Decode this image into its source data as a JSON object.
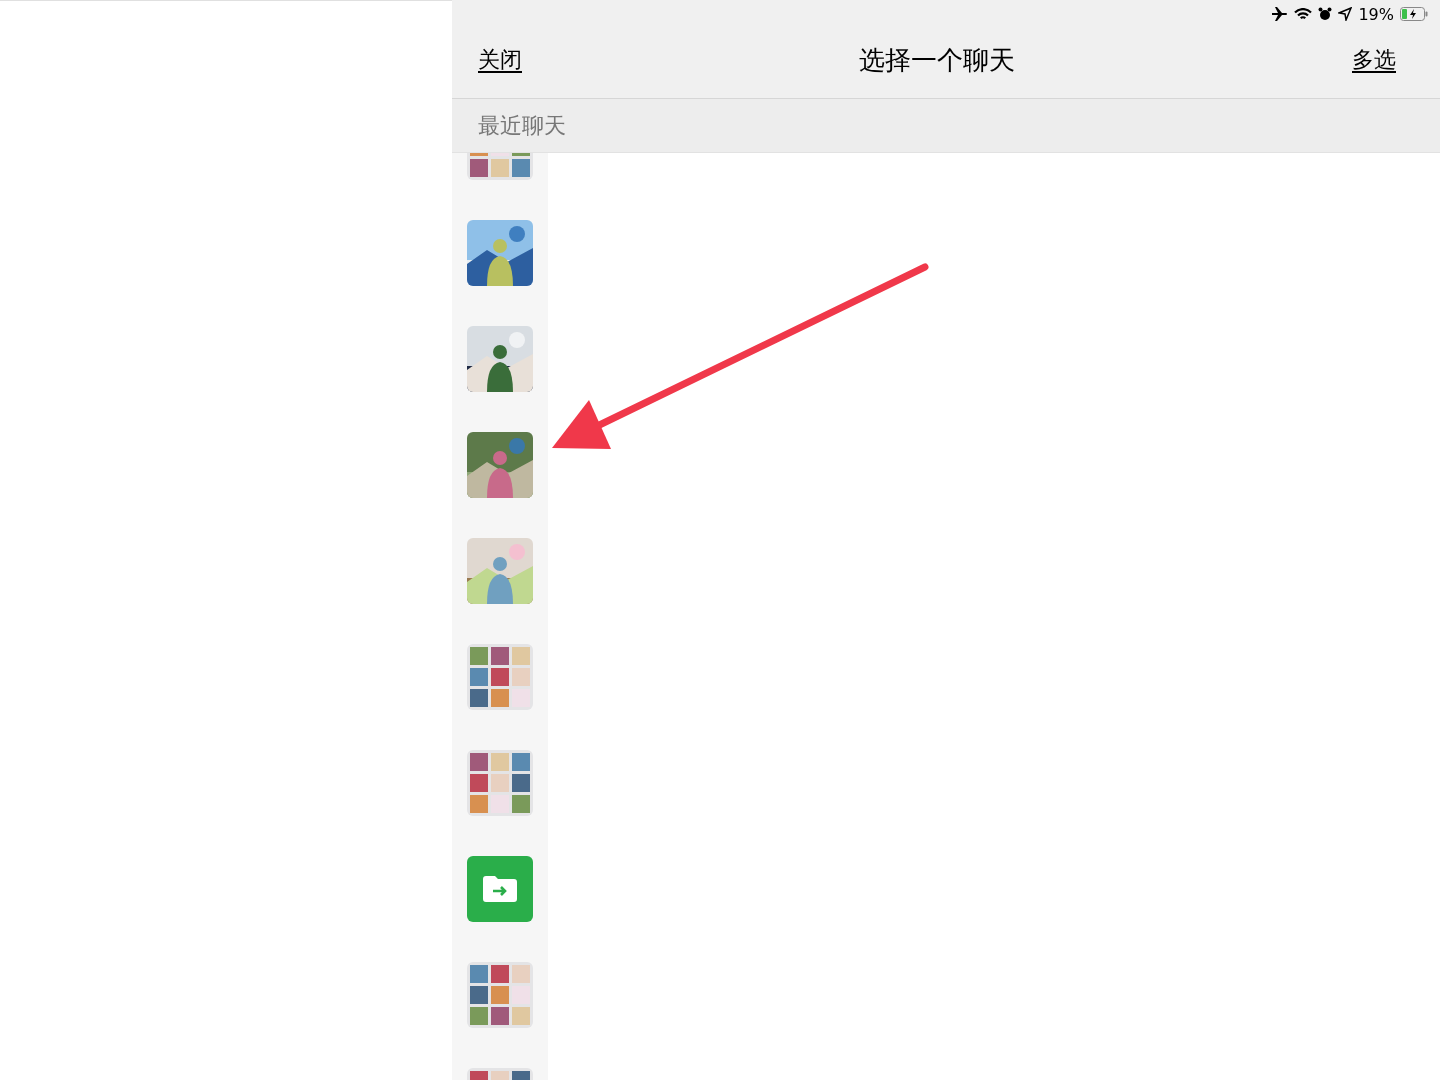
{
  "status_bar": {
    "battery": "19%"
  },
  "nav": {
    "close": "关闭",
    "title": "选择一个聊天",
    "multi_select": "多选"
  },
  "section": {
    "title": "最近聊天"
  },
  "chats": [
    {
      "kind": "group"
    },
    {
      "kind": "picture"
    },
    {
      "kind": "picture"
    },
    {
      "kind": "picture"
    },
    {
      "kind": "picture"
    },
    {
      "kind": "group"
    },
    {
      "kind": "group"
    },
    {
      "kind": "file"
    },
    {
      "kind": "group"
    },
    {
      "kind": "group"
    }
  ],
  "annotation": {
    "kind": "arrow"
  }
}
